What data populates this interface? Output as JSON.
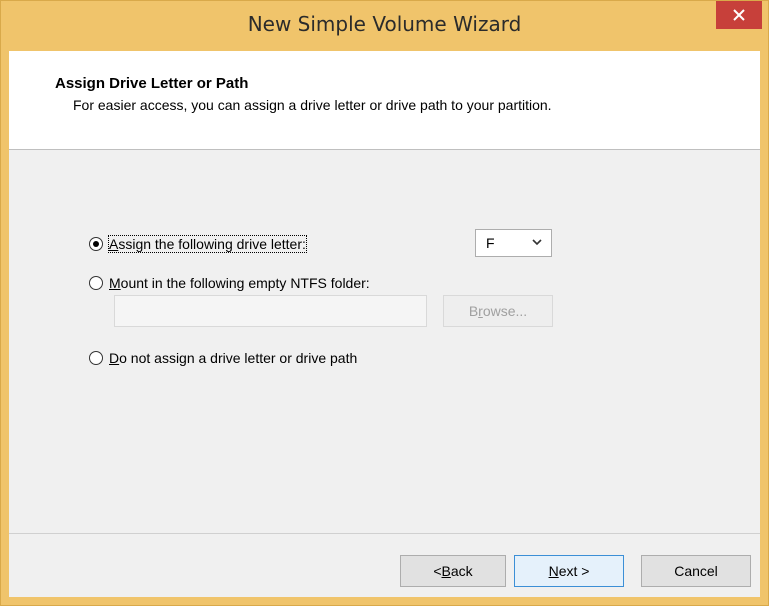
{
  "window": {
    "title": "New Simple Volume Wizard",
    "close_glyph": "✕",
    "accent_color": "#f0c46b",
    "close_color": "#c7403a"
  },
  "header": {
    "title": "Assign Drive Letter or Path",
    "subtitle": "For easier access, you can assign a drive letter or drive path to your partition."
  },
  "options": {
    "assign_letter": {
      "mnemonic": "A",
      "rest": "ssign the following drive letter:",
      "checked": true
    },
    "mount_folder": {
      "mnemonic": "M",
      "rest": "ount in the following empty NTFS folder:",
      "checked": false
    },
    "no_assign": {
      "mnemonic": "D",
      "rest": "o not assign a drive letter or drive path",
      "checked": false
    }
  },
  "drive_letter": {
    "value": "F",
    "icon": "chevron-down-icon"
  },
  "folder_path": {
    "value": ""
  },
  "browse": {
    "pre": "B",
    "mnemonic": "r",
    "rest": "owse...",
    "enabled": false
  },
  "footer": {
    "back": {
      "pre": "< ",
      "mnemonic": "B",
      "rest": "ack"
    },
    "next": {
      "mnemonic": "N",
      "rest": "ext >"
    },
    "cancel": "Cancel"
  }
}
